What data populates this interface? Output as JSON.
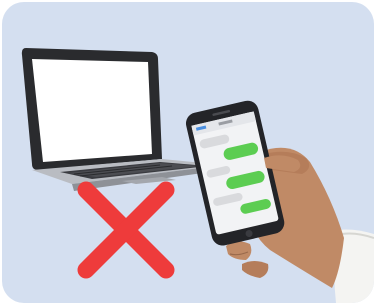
{
  "illustration": {
    "background_color": "#d4dff0",
    "laptop": {
      "screen_color": "#ffffff",
      "body_color": "#2a2b2e",
      "base_color": "#b9bcc2"
    },
    "phone": {
      "body_color": "#232428",
      "screen_color": "#f2f3f5",
      "sent_bubble_color": "#5ccd52",
      "received_bubble_color": "#d9dadd"
    },
    "cross_mark": {
      "icon": "red-x-icon",
      "color": "#ee3b3b"
    },
    "hand": {
      "skin_color": "#c08a66",
      "sleeve_color": "#f4f4f2"
    }
  }
}
